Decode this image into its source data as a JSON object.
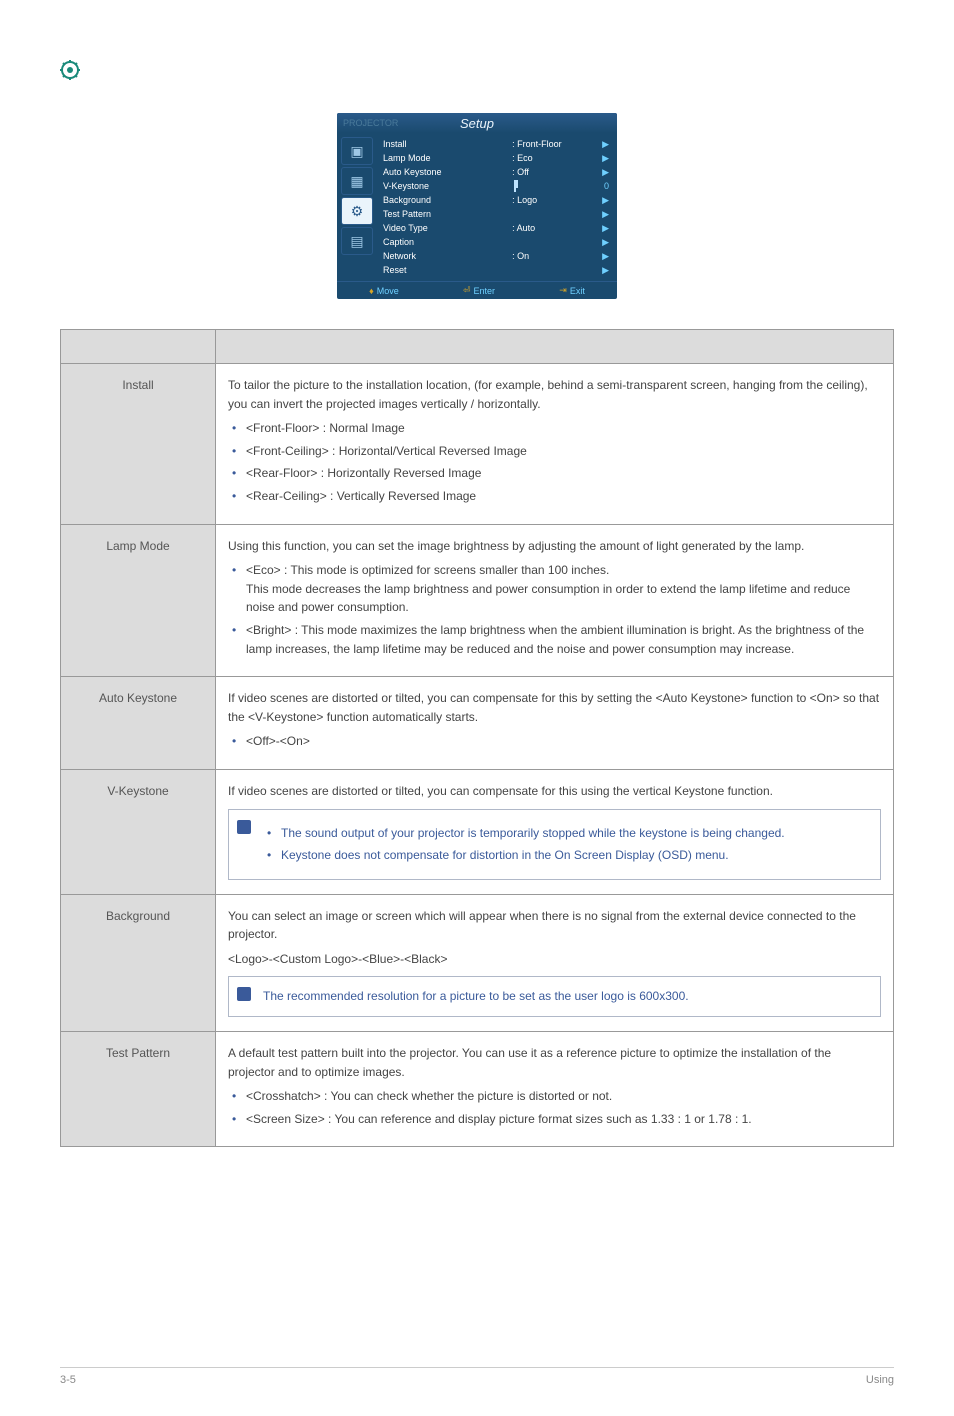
{
  "topIconName": "gear-icon",
  "osd": {
    "projectorTab": "PROJECTOR",
    "title": "Setup",
    "rows": [
      {
        "label": "Install",
        "value": ": Front-Floor",
        "arrow": "▶"
      },
      {
        "label": "Lamp Mode",
        "value": ": Eco",
        "arrow": "▶"
      },
      {
        "label": "Auto Keystone",
        "value": ": Off",
        "arrow": "▶"
      },
      {
        "label": "V-Keystone",
        "value": "slider",
        "arrow": "0"
      },
      {
        "label": "Background",
        "value": ": Logo",
        "arrow": "▶"
      },
      {
        "label": "Test Pattern",
        "value": "",
        "arrow": "▶"
      },
      {
        "label": "Video Type",
        "value": ": Auto",
        "arrow": "▶"
      },
      {
        "label": "Caption",
        "value": "",
        "arrow": "▶"
      },
      {
        "label": "Network",
        "value": ": On",
        "arrow": "▶"
      },
      {
        "label": "Reset",
        "value": "",
        "arrow": "▶"
      }
    ],
    "footer": {
      "move": "Move",
      "enter": "Enter",
      "exit": "Exit"
    }
  },
  "rows": {
    "install": {
      "title": "Install",
      "desc": "To tailor the picture to the installation location, (for example, behind a semi-transparent screen, hanging from the ceiling), you can invert the projected images vertically / horizontally.",
      "items": [
        "<Front-Floor> : Normal Image",
        "<Front-Ceiling> : Horizontal/Vertical Reversed Image",
        "<Rear-Floor> : Horizontally Reversed Image",
        "<Rear-Ceiling> : Vertically Reversed Image"
      ]
    },
    "lamp": {
      "title": "Lamp Mode",
      "desc": "Using this function, you can set the image brightness by adjusting the amount of light generated by the lamp.",
      "eco_lead": "<Eco> : This mode is optimized for screens smaller than 100 inches.",
      "eco_sub": "This mode decreases the lamp brightness and power consumption in order to extend the lamp lifetime and reduce noise and power consumption.",
      "bright": "<Bright> : This mode maximizes the lamp brightness when the ambient illumination is bright. As the brightness of the lamp increases, the lamp lifetime may be reduced and the noise and power consumption may increase."
    },
    "autokey": {
      "title": "Auto Keystone",
      "desc": "If video scenes are distorted or tilted, you can compensate for this by setting the <Auto Keystone> function to <On> so that the <V-Keystone> function automatically starts.",
      "item": "<Off>-<On>"
    },
    "vkey": {
      "title": "V-Keystone",
      "desc": "If video scenes are distorted or tilted, you can compensate for this using the vertical Keystone function.",
      "note1": "The sound output of your projector is temporarily stopped while the keystone is being changed.",
      "note2": "Keystone does not compensate for distortion in the On Screen Display (OSD) menu."
    },
    "bg": {
      "title": "Background",
      "desc": "You can select an image or screen which will appear when there is no signal from the external device connected to the projector.",
      "opts": "<Logo>-<Custom Logo>-<Blue>-<Black>",
      "note": "The recommended resolution for a picture to be set as the user logo is 600x300."
    },
    "test": {
      "title": "Test Pattern",
      "desc": "A default test pattern built into the projector. You can use it as a reference picture to optimize the installation of the projector and to optimize images.",
      "item1": "<Crosshatch> : You can check whether the picture is distorted or not.",
      "item2": "<Screen Size> : You can reference and display picture format sizes such as 1.33 : 1 or 1.78 : 1."
    }
  },
  "footer": {
    "left": "3-5",
    "right": "Using"
  }
}
